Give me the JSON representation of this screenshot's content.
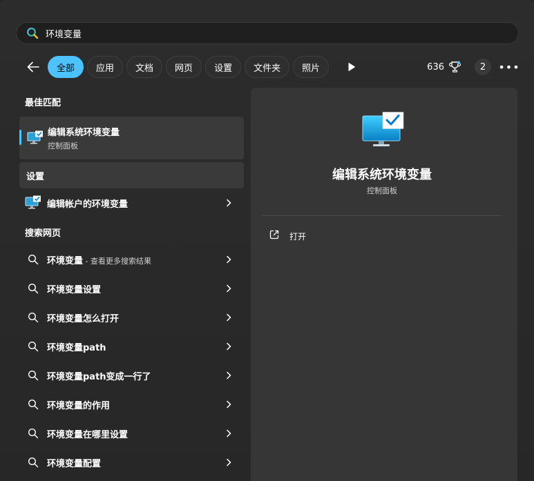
{
  "search": {
    "value": "环境变量"
  },
  "filters": [
    "全部",
    "应用",
    "文档",
    "网页",
    "设置",
    "文件夹",
    "照片"
  ],
  "toolbar": {
    "points": "636",
    "badge": "2",
    "more": "•••"
  },
  "left": {
    "best_match_title": "最佳匹配",
    "best_match": {
      "title": "编辑系统环境变量",
      "subtitle": "控制面板"
    },
    "settings_title": "设置",
    "settings_item": "编辑帐户的环境变量",
    "web_title": "搜索网页",
    "web_items": [
      {
        "text": "环境变量",
        "hint": " - 查看更多搜索结果"
      },
      {
        "text": "环境变量设置"
      },
      {
        "text": "环境变量怎么打开"
      },
      {
        "text": "环境变量path"
      },
      {
        "text": "环境变量path变成一行了"
      },
      {
        "text": "环境变量的作用"
      },
      {
        "text": "环境变量在哪里设置"
      },
      {
        "text": "环境变量配置"
      }
    ]
  },
  "detail": {
    "title": "编辑系统环境变量",
    "subtitle": "控制面板",
    "open_label": "打开"
  },
  "colors": {
    "accent": "#4cc2ff",
    "background": "#262626",
    "pane": "#363636"
  }
}
